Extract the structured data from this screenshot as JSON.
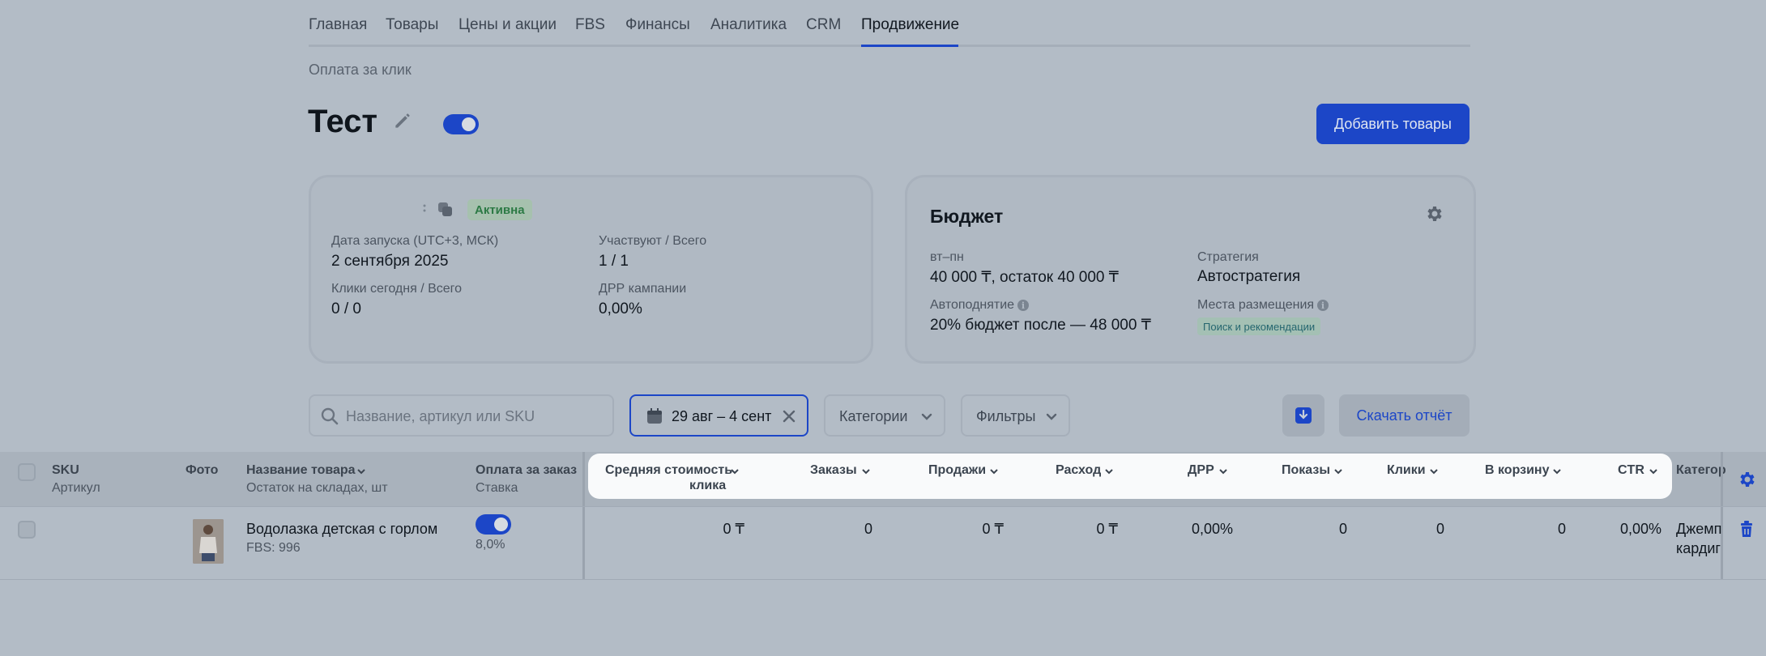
{
  "nav": {
    "tabs": [
      "Главная",
      "Товары",
      "Цены и акции",
      "FBS",
      "Финансы",
      "Аналитика",
      "CRM",
      "Продвижение"
    ],
    "active": "Продвижение"
  },
  "breadcrumb": "Оплата за клик",
  "page": {
    "title": "Тест",
    "add_button": "Добавить товары"
  },
  "campaign_card": {
    "status": "Активна",
    "launch_label": "Дата запуска (UTC+3, МСК)",
    "launch_value": "2 сентября 2025",
    "participate_label": "Участвуют / Всего",
    "participate_value": "1 / 1",
    "clicks_label": "Клики сегодня / Всего",
    "clicks_value": "0 / 0",
    "drr_label": "ДРР кампании",
    "drr_value": "0,00%"
  },
  "budget_card": {
    "title": "Бюджет",
    "days_label": "вт–пн",
    "days_value": "40 000 ₸, остаток 40 000 ₸",
    "strategy_label": "Стратегия",
    "strategy_value": "Автостратегия",
    "autoraise_label": "Автоподнятие",
    "autoraise_value": "20% бюджет после — 48 000 ₸",
    "placement_label": "Места размещения",
    "placement_tag": "Поиск и рекомендации"
  },
  "filters": {
    "search_placeholder": "Название, артикул или SKU",
    "date_range": "29 авг – 4 сент",
    "categories": "Категории",
    "filters": "Фильтры",
    "report_button": "Скачать отчёт"
  },
  "table": {
    "headers": {
      "sku": "SKU",
      "article": "Артикул",
      "photo": "Фото",
      "name": "Название товара",
      "stock": "Остаток на складах, шт",
      "pay": "Оплата за заказ",
      "rate": "Ставка",
      "avg_cost_1": "Средняя стоимость",
      "avg_cost_2": "клика",
      "orders": "Заказы",
      "sales": "Продажи",
      "spend": "Расход",
      "drr": "ДРР",
      "views": "Показы",
      "clicks": "Клики",
      "cart": "В корзину",
      "ctr": "CTR",
      "category": "Категор"
    },
    "rows": [
      {
        "name": "Водолазка детская с горлом",
        "fbs": "FBS: 996",
        "rate": "8,0%",
        "avg_cost": "0 ₸",
        "orders": "0",
        "sales": "0 ₸",
        "spend": "0 ₸",
        "drr": "0,00%",
        "views": "0",
        "clicks": "0",
        "cart": "0",
        "ctr": "0,00%",
        "category_1": "Джемп",
        "category_2": "кардиг"
      }
    ]
  },
  "colors": {
    "accent": "#1c46c7",
    "background": "#b3bcc6",
    "status_green": "#2c7a45"
  }
}
